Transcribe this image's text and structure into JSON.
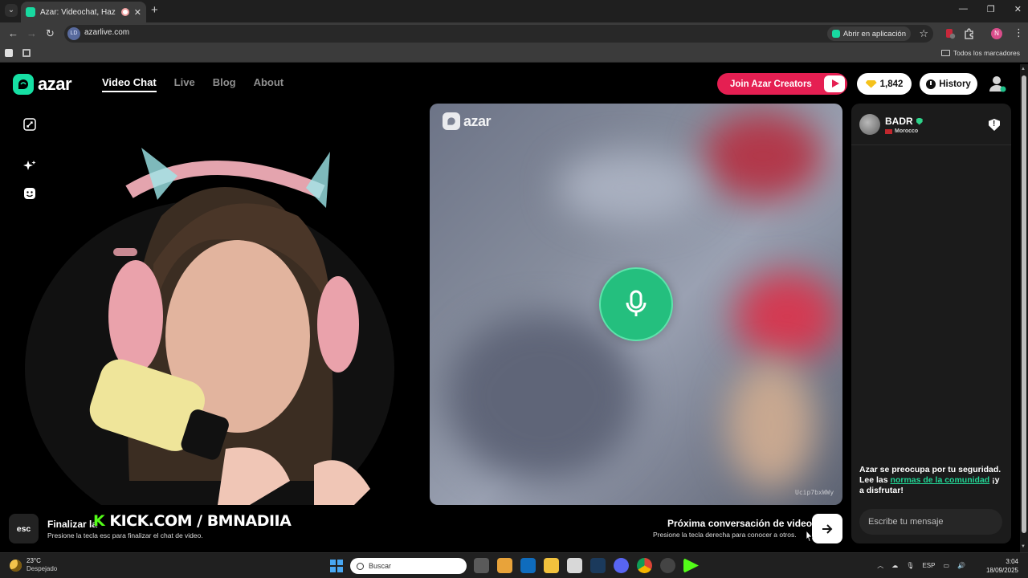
{
  "browser": {
    "tab_title": "Azar: Videochat, Haz nuevos amigos",
    "url": "azarlive.com",
    "site_chip": "LD",
    "open_in_app": "Abrir en aplicación",
    "profile_initial": "N",
    "all_bookmarks": "Todos los marcadores"
  },
  "header": {
    "logo_text": "azar",
    "nav": [
      "Video Chat",
      "Live",
      "Blog",
      "About"
    ],
    "join_label": "Join Azar Creators",
    "gems": "1,842",
    "history_label": "History"
  },
  "remote": {
    "logo_text": "azar",
    "watermark": "Ucip7bxWWy"
  },
  "chat": {
    "peer_name": "BADR",
    "peer_country": "Morocco",
    "safety_pre": "Azar se preocupa por tu seguridad. Lee las ",
    "safety_link": "normas de la comunidad",
    "safety_post": " ¡y a disfrutar!",
    "input_placeholder": "Escribe tu mensaje"
  },
  "actions": {
    "esc_key": "esc",
    "end_title": "Finalizar la",
    "end_sub": "Presione la tecla esc para finalizar el chat de video.",
    "overlay_k": "K",
    "overlay_text": " KICK.COM / BMNADIIA",
    "next_title": "Próxima conversación de video",
    "next_sub": "Presione la tecla derecha para conocer a otros."
  },
  "taskbar": {
    "temp": "23°C",
    "weather": "Despejado",
    "search_placeholder": "Buscar",
    "lang": "ESP",
    "time": "3:04",
    "date": "18/09/2025"
  },
  "colors": {
    "brand": "#16e0a4",
    "join": "#e51f52",
    "mic": "#24bf7e",
    "link": "#23d696"
  }
}
